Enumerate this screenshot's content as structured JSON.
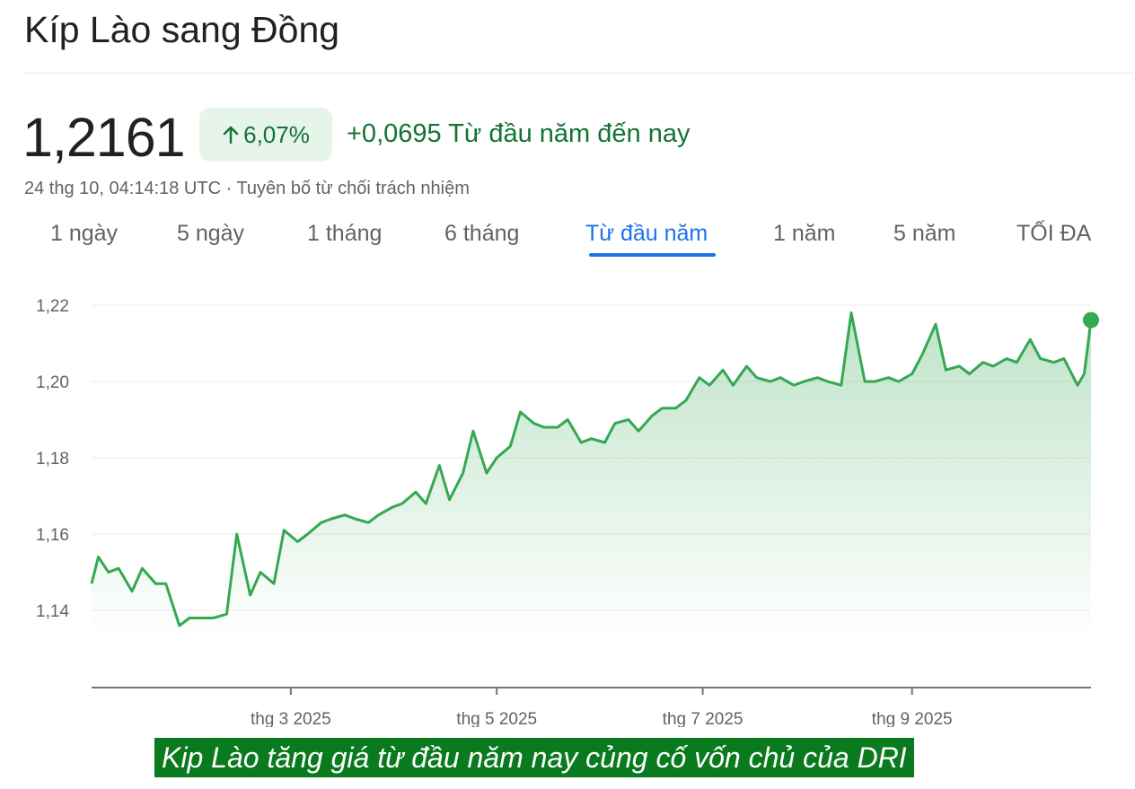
{
  "page": {
    "title": "Kíp Lào sang Đồng",
    "price": "1,2161",
    "change_badge": "6,07%",
    "change_text": "+0,0695 Từ đầu năm đến nay",
    "meta": "24 thg 10, 04:14:18 UTC · Tuyên bố từ chối trách nhiệm",
    "caption": "Kip Lào tăng giá từ đầu năm nay củng cố vốn chủ của DRI"
  },
  "tabs": [
    {
      "label": "1 ngày",
      "active": false
    },
    {
      "label": "5 ngày",
      "active": false
    },
    {
      "label": "1 tháng",
      "active": false
    },
    {
      "label": "6 tháng",
      "active": false
    },
    {
      "label": "Từ đầu năm",
      "active": true
    },
    {
      "label": "1 năm",
      "active": false
    },
    {
      "label": "5 năm",
      "active": false
    },
    {
      "label": "TỐI ĐA",
      "active": false
    }
  ],
  "colors": {
    "line": "#34a853",
    "positive_text": "#137333",
    "badge_bg": "#e6f4ea",
    "active_tab": "#1a73e8",
    "caption_bg": "#0a7a1e"
  },
  "chart_data": {
    "type": "area",
    "title": "",
    "xlabel": "",
    "ylabel": "",
    "ylim": [
      1.13,
      1.22
    ],
    "y_ticks": [
      1.14,
      1.16,
      1.18,
      1.2,
      1.22
    ],
    "y_tick_labels": [
      "1,14",
      "1,16",
      "1,18",
      "1,20",
      "1,22"
    ],
    "x_ticks": [
      {
        "label": "thg 3 2025",
        "x": "2025-03-01"
      },
      {
        "label": "thg 5 2025",
        "x": "2025-05-01"
      },
      {
        "label": "thg 7 2025",
        "x": "2025-07-01"
      },
      {
        "label": "thg 9 2025",
        "x": "2025-09-01"
      }
    ],
    "x_range": [
      "2025-01-01",
      "2025-10-24"
    ],
    "grid": true,
    "series": [
      {
        "x": [
          "2025-01-01",
          "2025-01-03",
          "2025-01-06",
          "2025-01-09",
          "2025-01-13",
          "2025-01-16",
          "2025-01-20",
          "2025-01-23",
          "2025-01-27",
          "2025-01-30",
          "2025-02-03",
          "2025-02-06",
          "2025-02-10",
          "2025-02-13",
          "2025-02-17",
          "2025-02-20",
          "2025-02-24",
          "2025-02-27",
          "2025-03-03",
          "2025-03-06",
          "2025-03-10",
          "2025-03-13",
          "2025-03-17",
          "2025-03-20",
          "2025-03-24",
          "2025-03-27",
          "2025-03-31",
          "2025-04-03",
          "2025-04-07",
          "2025-04-10",
          "2025-04-14",
          "2025-04-17",
          "2025-04-21",
          "2025-04-24",
          "2025-04-28",
          "2025-05-01",
          "2025-05-05",
          "2025-05-08",
          "2025-05-12",
          "2025-05-15",
          "2025-05-19",
          "2025-05-22",
          "2025-05-26",
          "2025-05-29",
          "2025-06-02",
          "2025-06-05",
          "2025-06-09",
          "2025-06-12",
          "2025-06-16",
          "2025-06-19",
          "2025-06-23",
          "2025-06-26",
          "2025-06-30",
          "2025-07-03",
          "2025-07-07",
          "2025-07-10",
          "2025-07-14",
          "2025-07-17",
          "2025-07-21",
          "2025-07-24",
          "2025-07-28",
          "2025-07-31",
          "2025-08-04",
          "2025-08-07",
          "2025-08-11",
          "2025-08-14",
          "2025-08-18",
          "2025-08-21",
          "2025-08-25",
          "2025-08-28",
          "2025-09-01",
          "2025-09-04",
          "2025-09-08",
          "2025-09-11",
          "2025-09-15",
          "2025-09-18",
          "2025-09-22",
          "2025-09-25",
          "2025-09-29",
          "2025-10-02",
          "2025-10-06",
          "2025-10-09",
          "2025-10-13",
          "2025-10-16",
          "2025-10-20",
          "2025-10-22",
          "2025-10-24"
        ],
        "values": [
          1.147,
          1.154,
          1.15,
          1.151,
          1.145,
          1.151,
          1.147,
          1.147,
          1.136,
          1.138,
          1.138,
          1.138,
          1.139,
          1.16,
          1.144,
          1.15,
          1.147,
          1.161,
          1.158,
          1.16,
          1.163,
          1.164,
          1.165,
          1.164,
          1.163,
          1.165,
          1.167,
          1.168,
          1.171,
          1.168,
          1.178,
          1.169,
          1.176,
          1.187,
          1.176,
          1.18,
          1.183,
          1.192,
          1.189,
          1.188,
          1.188,
          1.19,
          1.184,
          1.185,
          1.184,
          1.189,
          1.19,
          1.187,
          1.191,
          1.193,
          1.193,
          1.195,
          1.201,
          1.199,
          1.203,
          1.199,
          1.204,
          1.201,
          1.2,
          1.201,
          1.199,
          1.2,
          1.201,
          1.2,
          1.199,
          1.218,
          1.2,
          1.2,
          1.201,
          1.2,
          1.202,
          1.207,
          1.215,
          1.203,
          1.204,
          1.202,
          1.205,
          1.204,
          1.206,
          1.205,
          1.211,
          1.206,
          1.205,
          1.206,
          1.199,
          1.202,
          1.2161
        ]
      }
    ]
  }
}
